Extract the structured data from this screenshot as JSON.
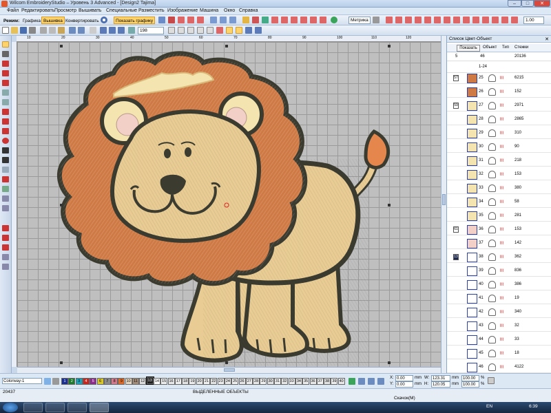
{
  "window": {
    "title": "Wilcom EmbroideryStudio – Уровень 3 Advanced - [Design2       Tajima]",
    "controls": {
      "min": "–",
      "max": "□",
      "close": "✕"
    }
  },
  "menu": [
    "Файл",
    "Редактировать",
    "Просмотр",
    "Вышивать",
    "Специальные",
    "Разместить",
    "Изображение",
    "Машина",
    "Окно",
    "Справка"
  ],
  "toolbar": {
    "mode_label": "Режим:",
    "modes": [
      "Графика",
      "Вышивка",
      "Конвертировать"
    ],
    "active_mode": "Вышивка",
    "show_graphics": "Показать графику",
    "zoom_value": "198",
    "units": "Метрика",
    "size_value": "1.00",
    "icon_names": [
      "new-icon",
      "open-icon",
      "save-icon",
      "print-icon",
      "cut-icon",
      "copy-icon",
      "paste-icon",
      "undo-icon",
      "redo-icon",
      "zoom-icon"
    ]
  },
  "ruler": {
    "h_marks": [
      "10",
      "20",
      "30",
      "40",
      "50",
      "60",
      "70",
      "80",
      "90",
      "100",
      "110",
      "120"
    ]
  },
  "colors": {
    "mane": "#cf7a45",
    "face": "#e8cc94",
    "body": "#e8cc94",
    "cream": "#f4e4b0",
    "outline": "#3b3b30",
    "tail_tip": "#e5874d",
    "ear_inner": "#f2d0c8",
    "canvas_bg": "#bfbfbf",
    "active_mode": "#ffd36b"
  },
  "panel": {
    "title": "Список Цвет-Объект",
    "show_button": "Показать",
    "col_object": "Объект",
    "col_type": "Тип",
    "col_stitches": "Стежки",
    "summary": {
      "c1": "5",
      "c2": "46",
      "c3": "20136"
    },
    "range_label": "1-24",
    "rows": [
      {
        "grp": "57",
        "num": "25",
        "cnt": "6215",
        "color": "#cf7a45"
      },
      {
        "grp": "",
        "num": "26",
        "cnt": "152",
        "color": "#cf7a45"
      },
      {
        "grp": "59",
        "num": "27",
        "cnt": "2971",
        "color": "#f4e4b0"
      },
      {
        "grp": "",
        "num": "28",
        "cnt": "2865",
        "color": "#f4e4b0"
      },
      {
        "grp": "",
        "num": "29",
        "cnt": "310",
        "color": "#f4e4b0"
      },
      {
        "grp": "",
        "num": "30",
        "cnt": "90",
        "color": "#f4e4b0"
      },
      {
        "grp": "",
        "num": "31",
        "cnt": "218",
        "color": "#f4e4b0"
      },
      {
        "grp": "",
        "num": "32",
        "cnt": "153",
        "color": "#f4e4b0"
      },
      {
        "grp": "",
        "num": "33",
        "cnt": "380",
        "color": "#f4e4b0"
      },
      {
        "grp": "",
        "num": "34",
        "cnt": "58",
        "color": "#f4e4b0"
      },
      {
        "grp": "",
        "num": "35",
        "cnt": "281",
        "color": "#f4e4b0"
      },
      {
        "grp": "61",
        "num": "36",
        "cnt": "153",
        "color": "#f2d0c8"
      },
      {
        "grp": "",
        "num": "37",
        "cnt": "142",
        "color": "#f2d0c8"
      },
      {
        "grp": "13",
        "num": "38",
        "cnt": "362",
        "color": "#ffffff"
      },
      {
        "grp": "",
        "num": "39",
        "cnt": "836",
        "color": "#ffffff"
      },
      {
        "grp": "",
        "num": "40",
        "cnt": "386",
        "color": "#ffffff"
      },
      {
        "grp": "",
        "num": "41",
        "cnt": "19",
        "color": "#ffffff"
      },
      {
        "grp": "",
        "num": "42",
        "cnt": "340",
        "color": "#ffffff"
      },
      {
        "grp": "",
        "num": "43",
        "cnt": "32",
        "color": "#ffffff"
      },
      {
        "grp": "",
        "num": "44",
        "cnt": "33",
        "color": "#ffffff"
      },
      {
        "grp": "",
        "num": "45",
        "cnt": "18",
        "color": "#ffffff"
      },
      {
        "grp": "",
        "num": "46",
        "cnt": "4122",
        "color": "#ffffff"
      }
    ]
  },
  "colorbar": {
    "colorway": "Colorway-1",
    "chips": [
      {
        "n": "1",
        "c": "#1b2f8f"
      },
      {
        "n": "2",
        "c": "#1f7a2e"
      },
      {
        "n": "3",
        "c": "#1aa3b8"
      },
      {
        "n": "4",
        "c": "#c7261f"
      },
      {
        "n": "5",
        "c": "#8e2c8e"
      },
      {
        "n": "6",
        "c": "#d8c62a"
      },
      {
        "n": "7",
        "c": "#8a8a8a"
      },
      {
        "n": "8",
        "c": "#d27a8b"
      },
      {
        "n": "9",
        "c": "#d86a2c"
      },
      {
        "n": "10",
        "c": "#e8d9c0"
      },
      {
        "n": "11",
        "c": "#a38d7a"
      },
      {
        "n": "12",
        "c": "#dddddd"
      },
      {
        "n": "13",
        "c": "#222222"
      },
      {
        "n": "14",
        "c": "#ffffff"
      },
      {
        "n": "15",
        "c": "#eeeeee"
      },
      {
        "n": "16",
        "c": "#e8e8e8"
      },
      {
        "n": "17",
        "c": "#f0f0f0"
      },
      {
        "n": "18",
        "c": "#e6e6e6"
      },
      {
        "n": "19",
        "c": "#ededed"
      },
      {
        "n": "20",
        "c": "#e9e9e9"
      },
      {
        "n": "21",
        "c": "#f2f2f2"
      },
      {
        "n": "22",
        "c": "#e4e4e4"
      },
      {
        "n": "23",
        "c": "#eeeeee"
      },
      {
        "n": "24",
        "c": "#e8e8e8"
      },
      {
        "n": "25",
        "c": "#f0f0f0"
      },
      {
        "n": "26",
        "c": "#e6e6e6"
      },
      {
        "n": "27",
        "c": "#ededed"
      },
      {
        "n": "28",
        "c": "#e9e9e9"
      },
      {
        "n": "29",
        "c": "#f2f2f2"
      },
      {
        "n": "30",
        "c": "#e4e4e4"
      },
      {
        "n": "31",
        "c": "#eeeeee"
      },
      {
        "n": "32",
        "c": "#e8e8e8"
      },
      {
        "n": "33",
        "c": "#f0f0f0"
      },
      {
        "n": "34",
        "c": "#e6e6e6"
      },
      {
        "n": "35",
        "c": "#ededed"
      },
      {
        "n": "36",
        "c": "#e9e9e9"
      },
      {
        "n": "37",
        "c": "#f2f2f2"
      },
      {
        "n": "38",
        "c": "#e4e4e4"
      },
      {
        "n": "39",
        "c": "#eeeeee"
      },
      {
        "n": "40",
        "c": "#e8e8e8"
      }
    ],
    "x_label": "X:",
    "x_val": "0.00",
    "y_label": "Y:",
    "y_val": "0.00",
    "w_label": "W:",
    "w_val": "123.31",
    "h_label": "H:",
    "h_val": "120.05",
    "units": "mm",
    "pct1": "100.00",
    "pct2": "100.00",
    "pct_sym": "%"
  },
  "status": {
    "left": "20437",
    "center": "ВЫДЕЛЕННЫЕ ОБЪЕКТЫ",
    "download": "Скачок(M)",
    "lang": "EN",
    "time": "6:39"
  }
}
